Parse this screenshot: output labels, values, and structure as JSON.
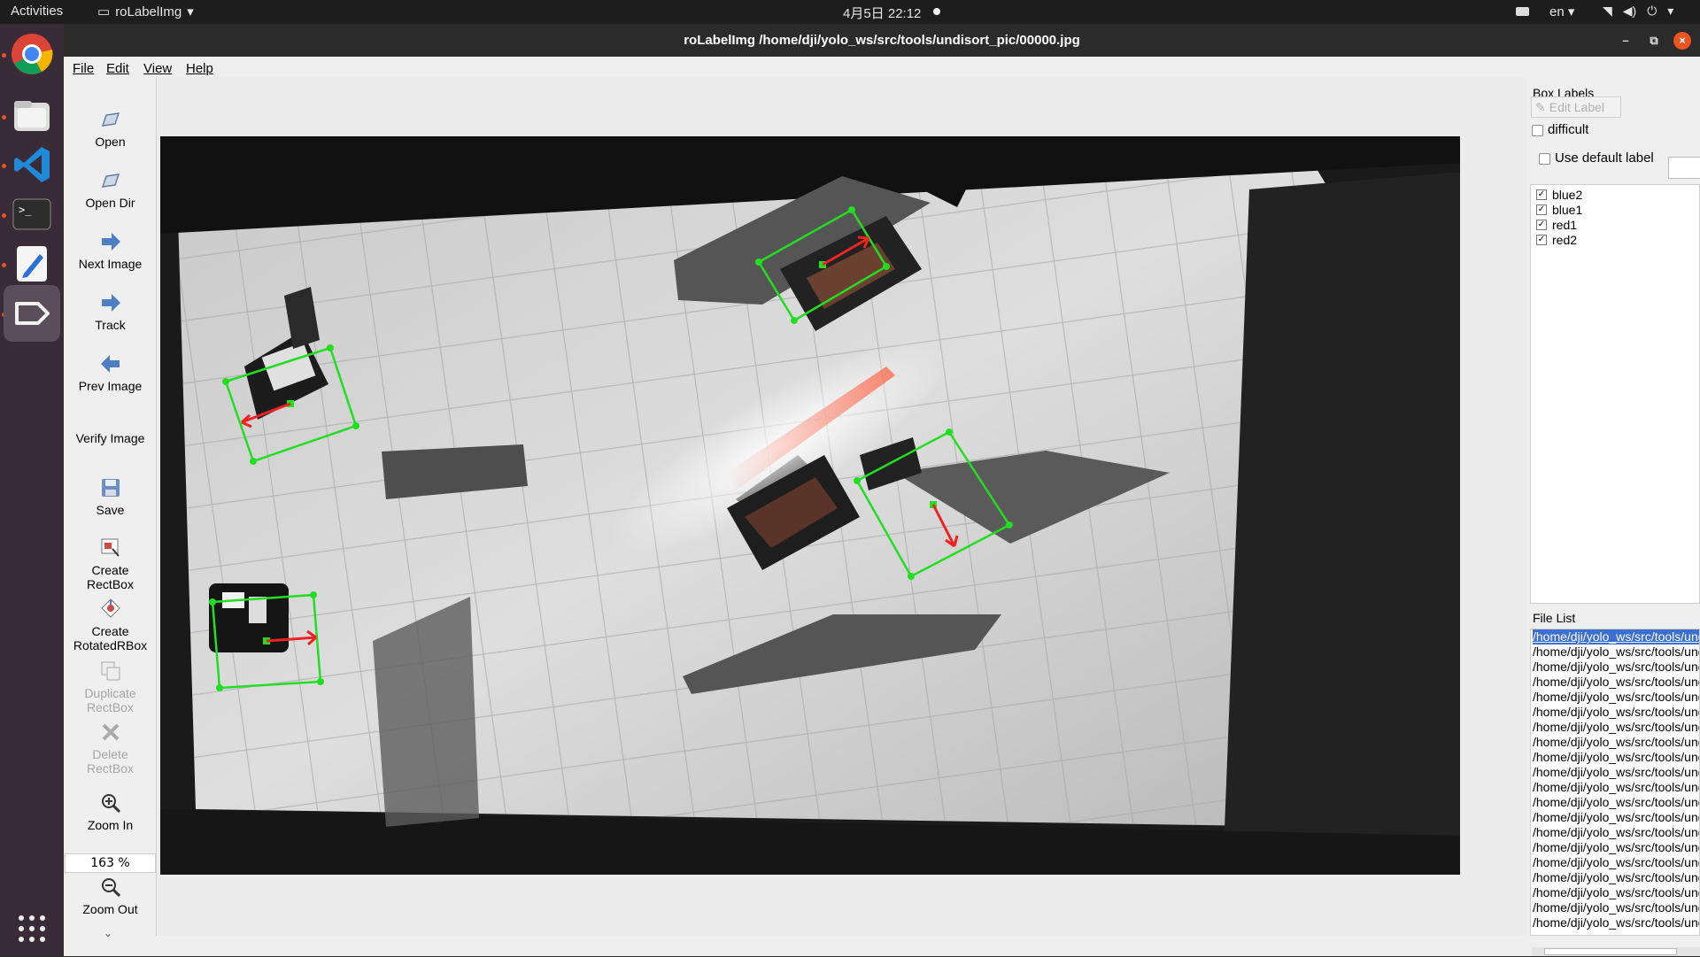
{
  "topbar": {
    "activities": "Activities",
    "app_menu": "roLabelImg",
    "clock": "4月5日  22:12",
    "lang": "en"
  },
  "window": {
    "title": "roLabelImg /home/dji/yolo_ws/src/tools/undisort_pic/00000.jpg"
  },
  "menu": [
    "File",
    "Edit",
    "View",
    "Help"
  ],
  "toolbar": {
    "open": "Open",
    "open_dir": "Open Dir",
    "next_image": "Next Image",
    "track": "Track",
    "prev_image": "Prev Image",
    "verify_image": "Verify Image",
    "save": "Save",
    "create_rectbox_1": "Create",
    "create_rectbox_2": "RectBox",
    "create_rotated_1": "Create",
    "create_rotated_2": "RotatedRBox",
    "duplicate_1": "Duplicate",
    "duplicate_2": "RectBox",
    "delete_1": "Delete",
    "delete_2": "RectBox",
    "zoom_in": "Zoom In",
    "zoom_value": "163 %",
    "zoom_out": "Zoom Out"
  },
  "box_labels": {
    "title": "Box Labels",
    "edit_label": "Edit Label",
    "difficult": "difficult",
    "use_default_label": "Use default label",
    "labels": [
      {
        "name": "blue2",
        "checked": true
      },
      {
        "name": "blue1",
        "checked": true
      },
      {
        "name": "red1",
        "checked": true
      },
      {
        "name": "red2",
        "checked": true
      }
    ]
  },
  "file_list": {
    "title": "File List",
    "files": [
      "/home/dji/yolo_ws/src/tools/undiso",
      "/home/dji/yolo_ws/src/tools/undiso",
      "/home/dji/yolo_ws/src/tools/undiso",
      "/home/dji/yolo_ws/src/tools/undiso",
      "/home/dji/yolo_ws/src/tools/undiso",
      "/home/dji/yolo_ws/src/tools/undiso",
      "/home/dji/yolo_ws/src/tools/undiso",
      "/home/dji/yolo_ws/src/tools/undiso",
      "/home/dji/yolo_ws/src/tools/undiso",
      "/home/dji/yolo_ws/src/tools/undiso",
      "/home/dji/yolo_ws/src/tools/undiso",
      "/home/dji/yolo_ws/src/tools/undiso",
      "/home/dji/yolo_ws/src/tools/undiso",
      "/home/dji/yolo_ws/src/tools/undiso",
      "/home/dji/yolo_ws/src/tools/undiso",
      "/home/dji/yolo_ws/src/tools/undiso",
      "/home/dji/yolo_ws/src/tools/undiso",
      "/home/dji/yolo_ws/src/tools/undiso",
      "/home/dji/yolo_ws/src/tools/undiso",
      "/home/dji/yolo_ws/src/tools/undiso"
    ]
  },
  "colors": {
    "box": "#22dd22",
    "arrow": "#ee2222",
    "selection": "#3c6fd1",
    "accent": "#e95420"
  }
}
